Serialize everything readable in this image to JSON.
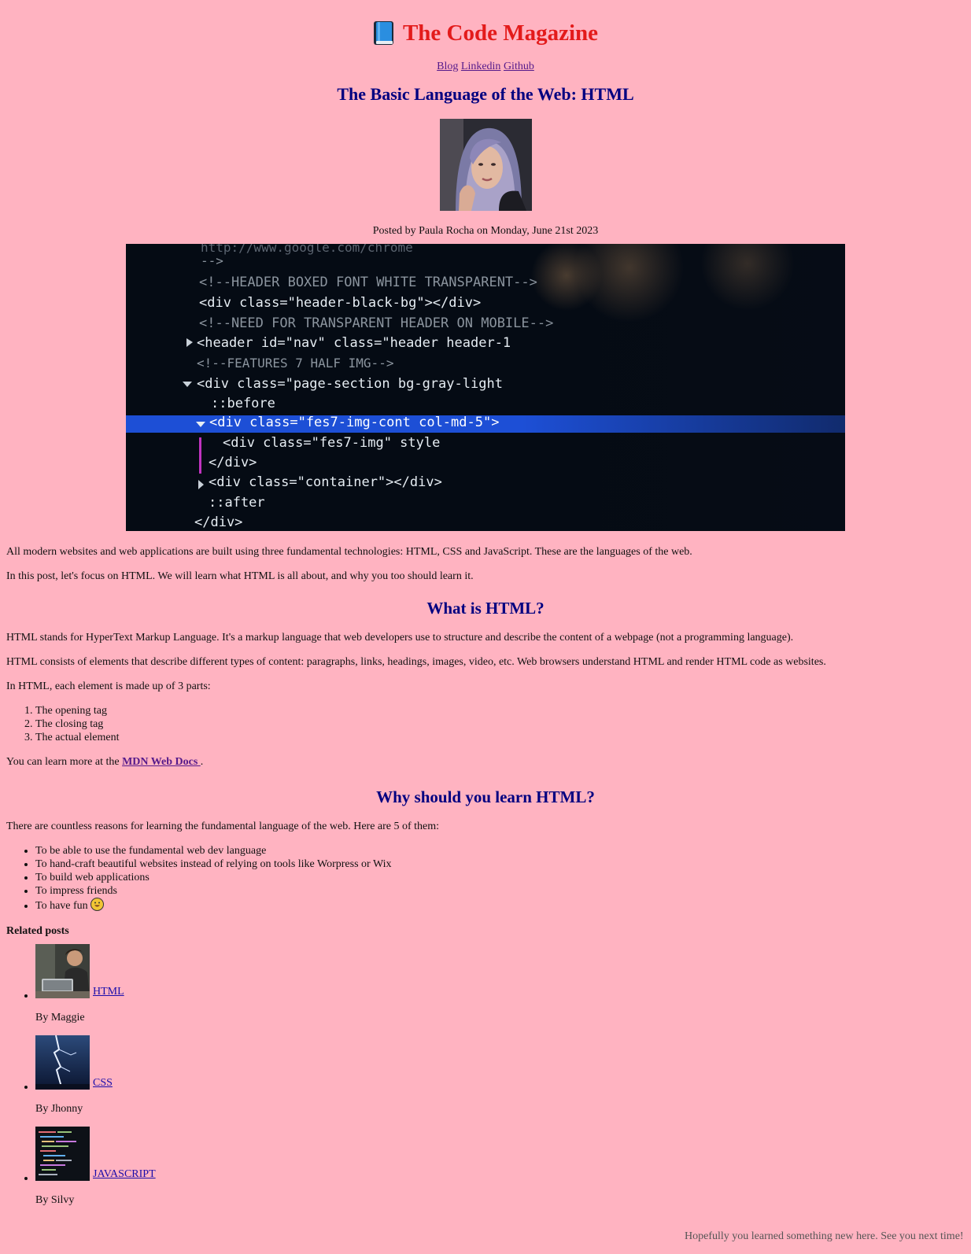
{
  "site": {
    "title": "The Code Magazine",
    "icon": "book-icon",
    "nav": [
      "Blog",
      "Linkedin",
      "Github"
    ]
  },
  "post": {
    "title": "The Basic Language of the Web: HTML",
    "byline": "Posted by Paula Rocha on Monday, June 21st 2023",
    "intro": [
      "All modern websites and web applications are built using three fundamental technologies: HTML, CSS and JavaScript. These are the languages of the web.",
      "In this post, let's focus on HTML. We will learn what HTML is all about, and why you too should learn it."
    ],
    "section1": {
      "heading": "What is HTML?",
      "paragraphs": [
        "HTML stands for HyperText Markup Language. It's a markup language that web developers use to structure and describe the content of a webpage (not a programming language).",
        "HTML consists of elements that describe different types of content: paragraphs, links, headings, images, video, etc. Web browsers understand HTML and render HTML code as websites.",
        "In HTML, each element is made up of 3 parts:"
      ],
      "parts": [
        "The opening tag",
        "The closing tag",
        "The actual element"
      ],
      "learn_more_prefix": "You can learn more at the ",
      "learn_more_link": "MDN Web Docs ",
      "learn_more_suffix": "."
    },
    "section2": {
      "heading": "Why should you learn HTML?",
      "intro": "There are countless reasons for learning the fundamental language of the web. Here are 5 of them:",
      "reasons": [
        "To be able to use the fundamental web dev language",
        "To hand-craft beautiful websites instead of relying on tools like Worpress or Wix",
        "To build web applications",
        "To impress friends",
        "To have fun"
      ]
    }
  },
  "hero_code": [
    "  http://www.google.com/chrome",
    "-->",
    "<!--HEADER BOXED FONT WHITE TRANSPARENT-->",
    "<div class=\"header-black-bg\"></div>",
    "<!--NEED FOR TRANSPARENT HEADER ON MOBILE-->",
    "<header id=\"nav\" class=\"header header-1",
    "<!--FEATURES 7 HALF IMG-->",
    "<div class=\"page-section bg-gray-light",
    "::before",
    "<div class=\"fes7-img-cont col-md-5\">",
    "<div class=\"fes7-img\" style",
    "</div>",
    "<div class=\"container\"></div>",
    "::after",
    "</div>"
  ],
  "related": {
    "title": "Related posts",
    "items": [
      {
        "label": "HTML",
        "author": "By Maggie"
      },
      {
        "label": "CSS",
        "author": "By Jhonny"
      },
      {
        "label": "JAVASCRIPT",
        "author": "By Silvy"
      }
    ]
  },
  "footer": "Hopefully you learned something new here. See you next time!",
  "colors": {
    "background": "#ffb3c1",
    "site_title": "#e31b1b",
    "headings": "#000080"
  }
}
